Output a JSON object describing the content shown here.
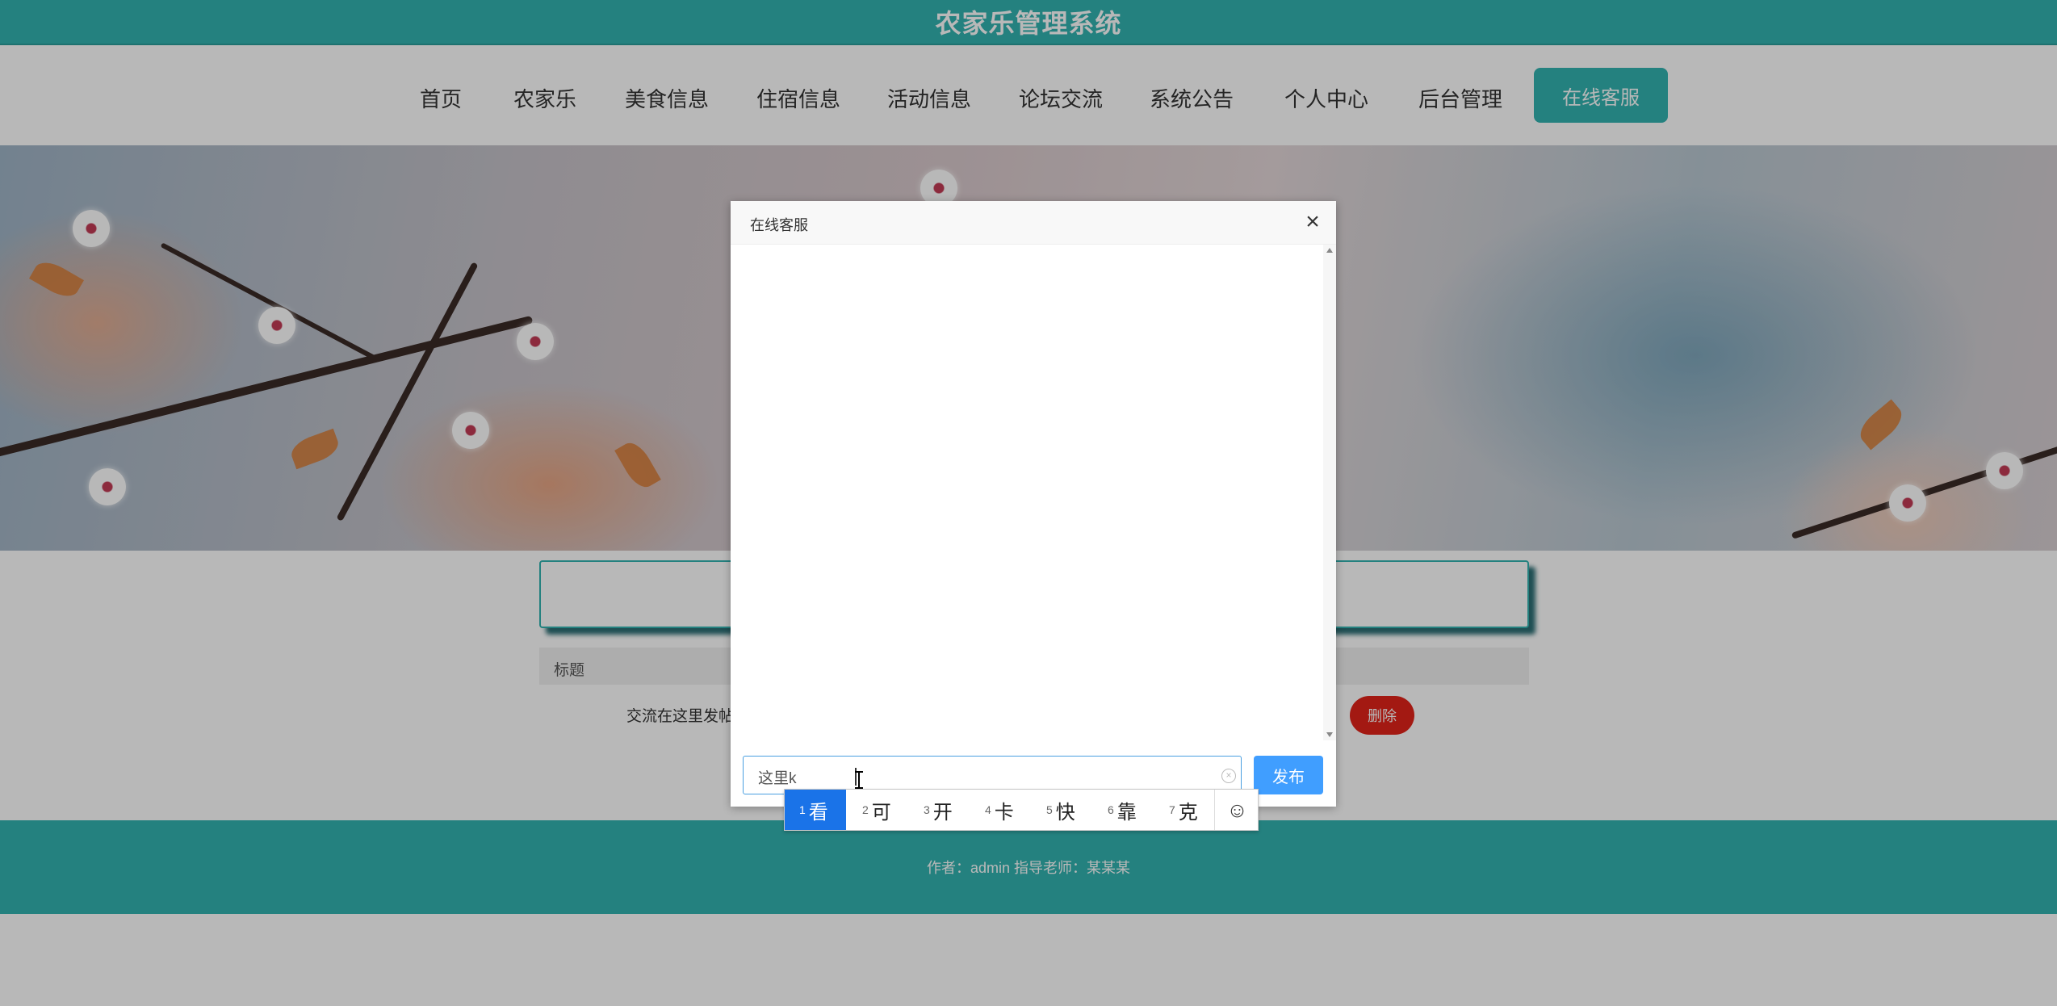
{
  "site": {
    "title": "农家乐管理系统"
  },
  "nav": {
    "items": [
      "首页",
      "农家乐",
      "美食信息",
      "住宿信息",
      "活动信息",
      "论坛交流",
      "系统公告",
      "个人中心",
      "后台管理"
    ],
    "service_button": "在线客服"
  },
  "table": {
    "header_title": "标题"
  },
  "post": {
    "title": "交流在这里发帖",
    "delete_label": "删除"
  },
  "footer": {
    "text": "作者：admin 指导老师：某某某"
  },
  "dialog": {
    "title": "在线客服",
    "close_icon": "close-icon",
    "input_value": "这里k",
    "publish_label": "发布"
  },
  "ime": {
    "candidates": [
      {
        "num": "1",
        "char": "看"
      },
      {
        "num": "2",
        "char": "可"
      },
      {
        "num": "3",
        "char": "开"
      },
      {
        "num": "4",
        "char": "卡"
      },
      {
        "num": "5",
        "char": "快"
      },
      {
        "num": "6",
        "char": "靠"
      },
      {
        "num": "7",
        "char": "克"
      }
    ],
    "emoji_icon": "smiley-icon",
    "active_index": 0
  },
  "colors": {
    "theme": "#33b3b0",
    "primary": "#409eff",
    "danger": "#e2231a",
    "ime_highlight": "#1a73e8"
  }
}
